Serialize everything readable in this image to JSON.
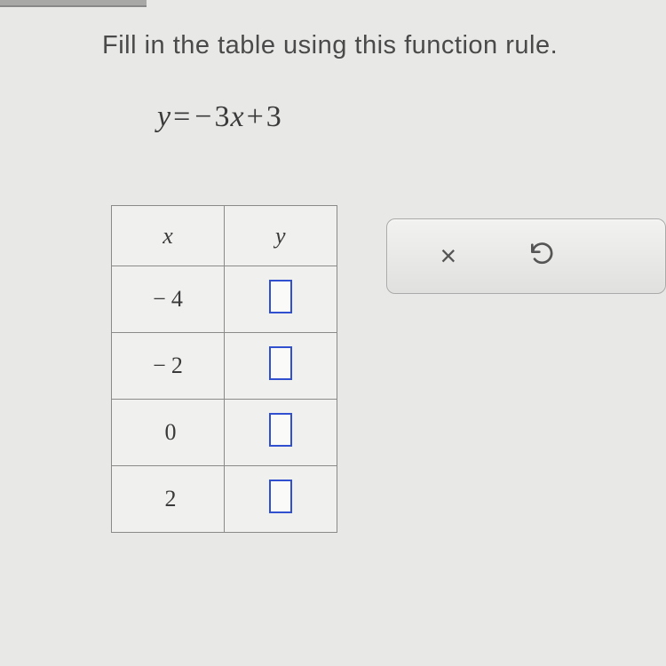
{
  "instruction": "Fill in the table using this function rule.",
  "equation": {
    "lhs": "y",
    "eq": "=",
    "neg": "−",
    "coef": "3",
    "var": "x",
    "plus": "+",
    "const": "3"
  },
  "table": {
    "header_x": "x",
    "header_y": "y",
    "rows": [
      {
        "x_neg": "−",
        "x_val": "4"
      },
      {
        "x_neg": "−",
        "x_val": "2"
      },
      {
        "x_neg": "",
        "x_val": "0"
      },
      {
        "x_neg": "",
        "x_val": "2"
      }
    ]
  },
  "toolbar": {
    "clear_symbol": "×"
  }
}
